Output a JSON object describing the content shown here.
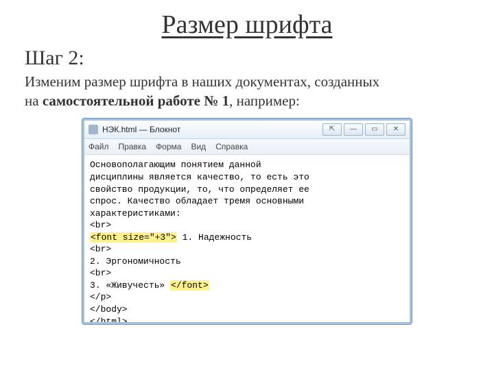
{
  "title": "Размер шрифта",
  "step_label": "Шаг 2:",
  "body_prefix": "Изменим размер шрифта в наших документах, созданных на ",
  "body_bold": "самостоятельной работе № 1",
  "body_suffix": ", например:",
  "window": {
    "caption": "НЭК.html — Блокнот",
    "menus": [
      "Файл",
      "Правка",
      "Форма",
      "Вид",
      "Справка"
    ],
    "btn_min": "—",
    "btn_max": "▭",
    "btn_close": "✕",
    "btn_zoom": "⇱"
  },
  "code": {
    "l1": "Основополагающим понятием данной",
    "l2": "дисциплины является качество, то есть это",
    "l3": "свойство продукции, то, что определяет ее",
    "l4": "спрос. Качество обладает тремя основными",
    "l5": "характеристиками:",
    "l6": "<br>",
    "l7_hl": "<font size=\"+3\">",
    "l7_rest": " 1. Надежность",
    "l8": "<br>",
    "l9": "2. Эргономичность",
    "l10": "<br>",
    "l11_a": "3. «Живучесть» ",
    "l11_hl": "</font>",
    "l12": "</p>",
    "l13": "</body>",
    "l14": "</html>"
  }
}
